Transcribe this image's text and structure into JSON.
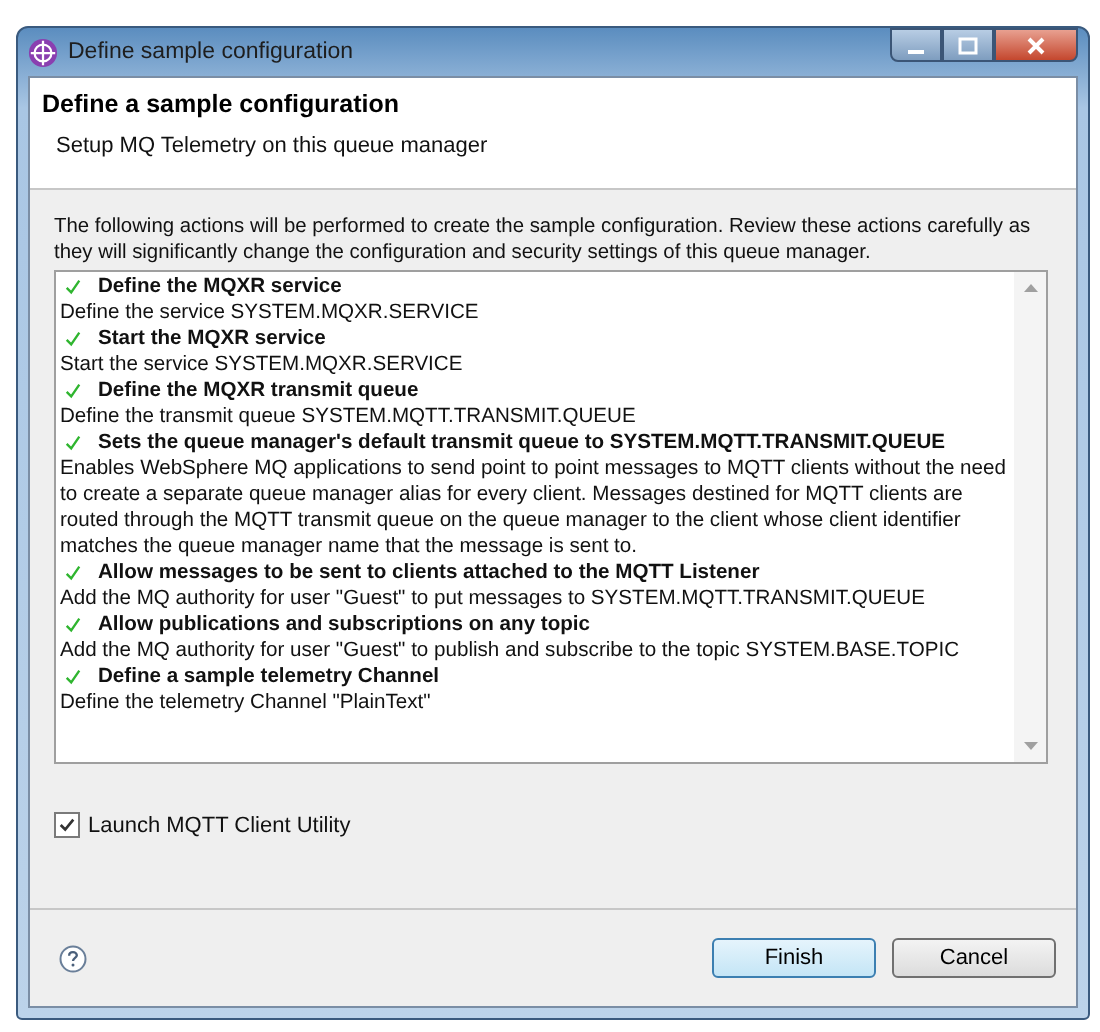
{
  "window": {
    "title": "Define sample configuration"
  },
  "header": {
    "title": "Define a sample configuration",
    "subtitle": "Setup MQ Telemetry on this queue manager"
  },
  "intro": "The following actions will be performed to create the sample configuration. Review these actions carefully as they will significantly change the configuration and security settings of this queue manager.",
  "actions": [
    {
      "title": "Define the MQXR service",
      "description": "Define the service SYSTEM.MQXR.SERVICE"
    },
    {
      "title": "Start the MQXR service",
      "description": "Start the service SYSTEM.MQXR.SERVICE"
    },
    {
      "title": "Define the MQXR transmit queue",
      "description": "Define the transmit queue SYSTEM.MQTT.TRANSMIT.QUEUE"
    },
    {
      "title": "Sets the queue manager's default transmit queue to SYSTEM.MQTT.TRANSMIT.QUEUE",
      "description": "Enables WebSphere MQ applications to send point to point messages to MQTT clients without the need to create a separate queue manager alias for every client. Messages destined for MQTT clients are routed through the MQTT transmit queue on the queue manager to the client whose client identifier matches the queue manager name that the message is sent to."
    },
    {
      "title": "Allow messages to be sent to clients attached to the MQTT Listener",
      "description": "Add the MQ authority for user \"Guest\" to put messages to SYSTEM.MQTT.TRANSMIT.QUEUE"
    },
    {
      "title": "Allow publications and subscriptions on any topic",
      "description": "Add the MQ authority for user \"Guest\" to publish and subscribe to the topic SYSTEM.BASE.TOPIC"
    },
    {
      "title": "Define a sample telemetry Channel",
      "description": "Define the telemetry Channel \"PlainText\""
    }
  ],
  "launch_option": {
    "label": "Launch MQTT Client Utility",
    "checked": true
  },
  "buttons": [
    {
      "label": "Finish",
      "default": true
    },
    {
      "label": "Cancel",
      "default": false
    }
  ]
}
